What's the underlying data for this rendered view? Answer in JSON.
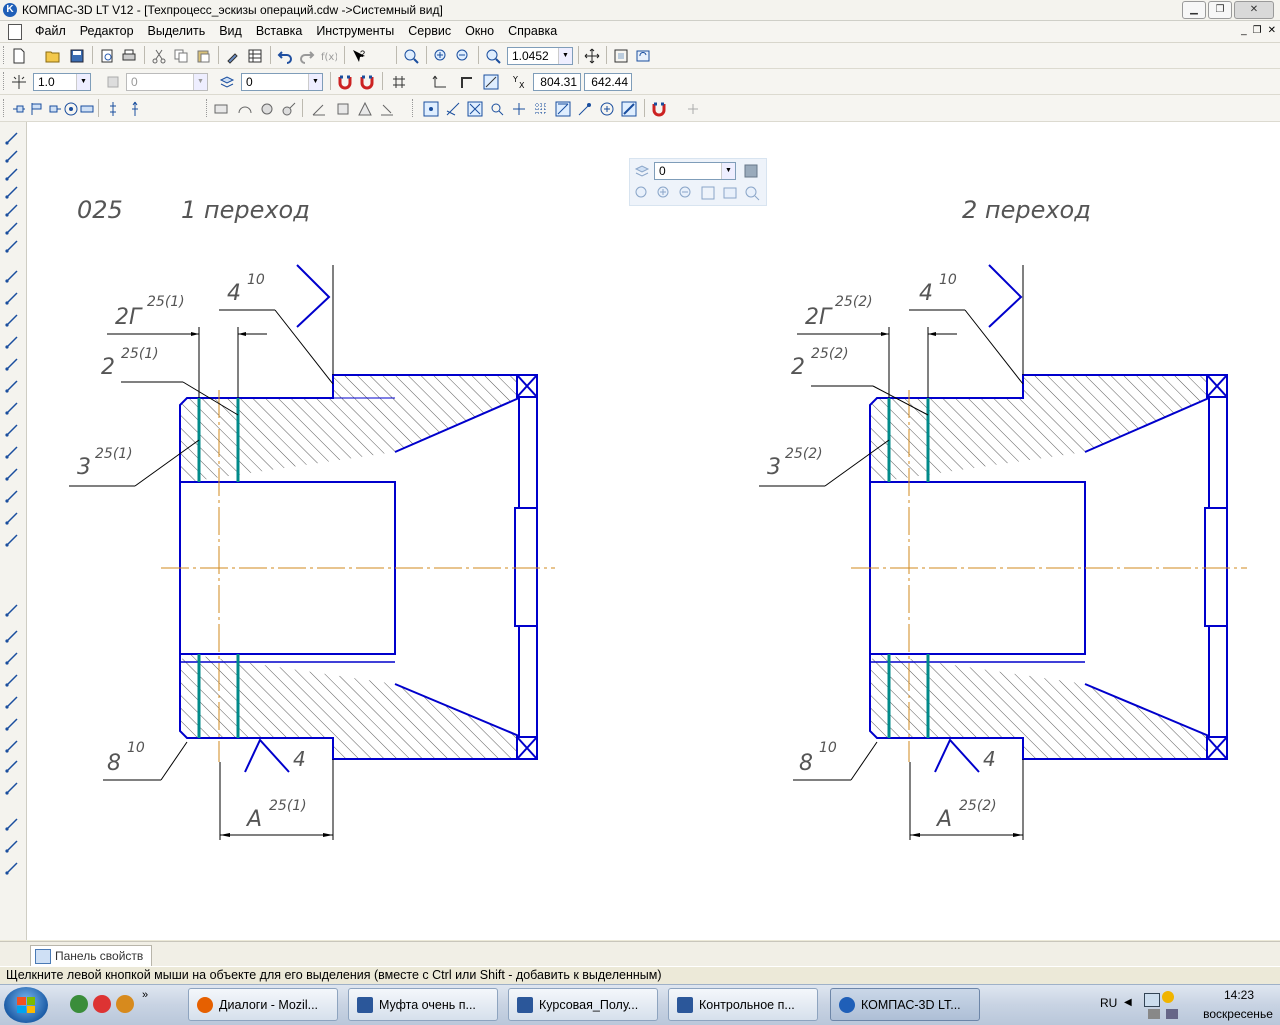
{
  "window": {
    "title": "КОМПАС-3D LT V12 - [Техпроцесс_эскизы операций.cdw ->Системный вид]",
    "app_icon": "K"
  },
  "menu": {
    "items": [
      "Файл",
      "Редактор",
      "Выделить",
      "Вид",
      "Вставка",
      "Инструменты",
      "Сервис",
      "Окно",
      "Справка"
    ]
  },
  "toolbar1": {
    "zoom": "1.0452"
  },
  "toolbar2": {
    "step": "1.0",
    "state_disabled": "0",
    "layer": "0",
    "x_coord": "804.31",
    "y_coord": "642.44"
  },
  "view_toolbar": {
    "layer": "0"
  },
  "drawing": {
    "operation_number": "025",
    "step1_title": "1 переход",
    "step2_title": "2 переход",
    "roughness": "4",
    "roughness_index": "10",
    "left": {
      "dim_2g": "2Г",
      "dim_2g_sup": "25(1)",
      "dim_2": "2",
      "dim_2_sup": "25(1)",
      "dim_3": "3",
      "dim_3_sup": "25(1)",
      "dim_8": "8",
      "dim_8_sup": "10",
      "dim_a": "A",
      "dim_a_sup": "25(1)",
      "base_mark": "4"
    },
    "right": {
      "dim_2g": "2Г",
      "dim_2g_sup": "25(2)",
      "dim_2": "2",
      "dim_2_sup": "25(2)",
      "dim_3": "3",
      "dim_3_sup": "25(2)",
      "dim_8": "8",
      "dim_8_sup": "10",
      "dim_a": "A",
      "dim_a_sup": "25(2)",
      "base_mark": "4"
    },
    "colors": {
      "contour": "#0000cc",
      "axis": "#d28a1e",
      "tool_path": "#008a8a",
      "hatch": "#333333"
    }
  },
  "properties_panel": {
    "tab_label": "Панель свойств"
  },
  "status": {
    "hint": "Щелкните левой кнопкой мыши на объекте для его выделения (вместе с Ctrl или Shift - добавить к выделенным)"
  },
  "taskbar": {
    "tasks": [
      {
        "label": "Диалоги - Mozil...",
        "icon": "firefox-icon"
      },
      {
        "label": "Муфта очень п...",
        "icon": "word-icon"
      },
      {
        "label": "Курсовая_Полу...",
        "icon": "word-icon"
      },
      {
        "label": "Контрольное п...",
        "icon": "word-icon"
      },
      {
        "label": "КОМПАС-3D LT...",
        "icon": "kompas-icon"
      }
    ],
    "language": "RU",
    "time": "14:23",
    "day": "воскресенье"
  }
}
